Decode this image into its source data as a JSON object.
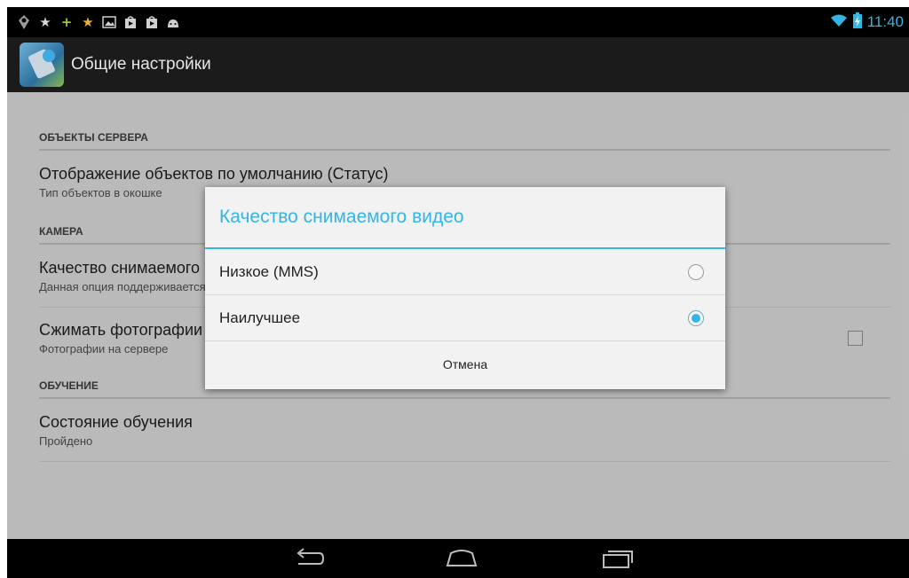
{
  "status_bar": {
    "time": "11:40",
    "notification_icons": [
      "location-icon",
      "star-icon",
      "plus-icon",
      "star-gold-icon",
      "image-icon",
      "store-icon",
      "store-icon",
      "android-icon"
    ],
    "system_icons": [
      "wifi-icon",
      "battery-charging-icon"
    ]
  },
  "action_bar": {
    "title": "Общие настройки"
  },
  "settings": {
    "cat_server": "ОБЪЕКТЫ СЕРВЕРА",
    "display_objects": {
      "title": "Отображение объектов по умолчанию (Статус)",
      "summary": "Тип объектов в окошке"
    },
    "cat_camera": "КАМЕРА",
    "video_quality": {
      "title": "Качество снимаемого видео",
      "summary": "Данная опция поддерживается"
    },
    "compress_photos": {
      "title": "Сжимать фотографии",
      "summary": "Фотографии на сервере",
      "checked": false
    },
    "cat_training": "ОБУЧЕНИЕ",
    "training_state": {
      "title": "Состояние обучения",
      "summary": "Пройдено"
    }
  },
  "dialog": {
    "title": "Качество снимаемого видео",
    "options": [
      {
        "label": "Низкое (MMS)",
        "selected": false
      },
      {
        "label": "Наилучшее",
        "selected": true
      }
    ],
    "cancel_label": "Отмена"
  },
  "colors": {
    "accent": "#33b5e5",
    "actionbar": "#1b1b1b",
    "background": "#efefef"
  }
}
